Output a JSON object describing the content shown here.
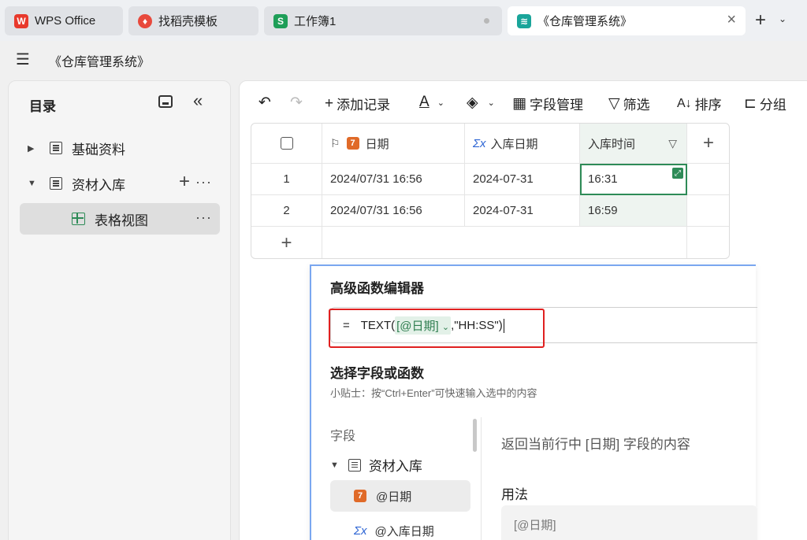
{
  "tabs": [
    {
      "label": "WPS Office",
      "icon": "wps-logo-icon"
    },
    {
      "label": "找稻壳模板",
      "icon": "docer-icon"
    },
    {
      "label": "工作簿1",
      "icon": "spreadsheet-s-icon"
    },
    {
      "label": "《仓库管理系统》",
      "icon": "multidim-table-icon",
      "active": true
    }
  ],
  "header": {
    "doc_title": "《仓库管理系统》"
  },
  "sidebar": {
    "title": "目录",
    "items": [
      {
        "label": "基础资料"
      },
      {
        "label": "资材入库"
      },
      {
        "label": "表格视图"
      }
    ]
  },
  "toolbar": {
    "add_record": "添加记录",
    "text_color_glyph": "A",
    "field_manage": "字段管理",
    "filter": "筛选",
    "sort": "排序",
    "group": "分组"
  },
  "grid": {
    "columns": [
      "日期",
      "入库日期",
      "入库时间"
    ],
    "rows": [
      {
        "num": "1",
        "date": "2024/07/31 16:56",
        "in_date": "2024-07-31",
        "in_time": "16:31"
      },
      {
        "num": "2",
        "date": "2024/07/31 16:56",
        "in_date": "2024-07-31",
        "in_time": "16:59"
      }
    ],
    "date_field_glyph": "7",
    "sigma_glyph": "Σx"
  },
  "editor": {
    "title": "高级函数编辑器",
    "formula_eq": "=",
    "formula_prefix": "TEXT(",
    "formula_tag": "[@日期]",
    "formula_suffix": ",\"HH:SS\")",
    "section_title": "选择字段或函数",
    "tip": "小贴士：按“Ctrl+Enter”可快速输入选中的内容",
    "fields_label": "字段",
    "group_label": "资材入库",
    "field_items": [
      "@日期",
      "@入库日期"
    ],
    "description": "返回当前行中 [日期] 字段的内容",
    "usage_label": "用法",
    "usage_value": "[@日期]"
  },
  "colors": {
    "accent": "#2e8b57",
    "highlight_border": "#e02020",
    "editor_border": "#7aa7f0"
  }
}
